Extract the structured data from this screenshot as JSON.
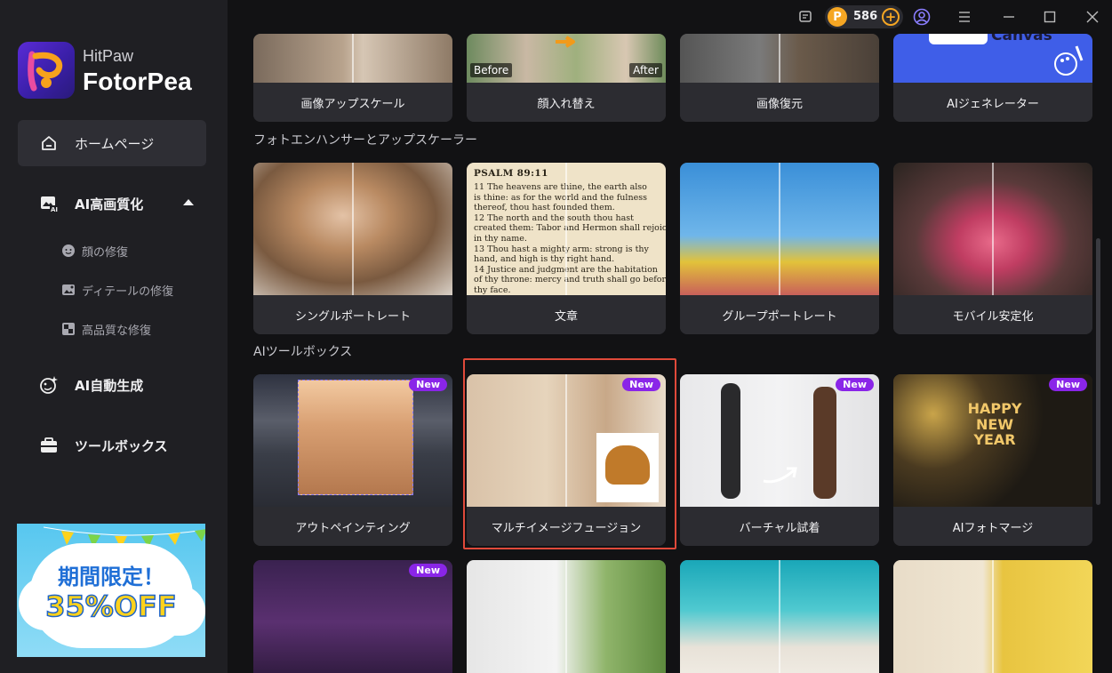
{
  "app": {
    "brand_top": "HitPaw",
    "brand_name": "FotorPea"
  },
  "topbar": {
    "coins": "586"
  },
  "sidebar": {
    "items": [
      {
        "label": "ホームページ",
        "icon": "home-icon"
      },
      {
        "label": "AI高画質化",
        "icon": "enhance-image-icon"
      },
      {
        "label": "AI自動生成",
        "icon": "ai-generate-icon"
      },
      {
        "label": "ツールボックス",
        "icon": "toolbox-icon"
      }
    ],
    "sub_items": [
      {
        "label": "顔の修復",
        "icon": "face-icon"
      },
      {
        "label": "ディテールの修復",
        "icon": "image-detail-icon"
      },
      {
        "label": "高品質な修復",
        "icon": "quality-icon"
      }
    ],
    "promo": {
      "line1": "期間限定！",
      "line2": "35%OFF"
    }
  },
  "row0": [
    {
      "label": "画像アップスケール"
    },
    {
      "label": "顔入れ替え",
      "before": "Before",
      "after": "After"
    },
    {
      "label": "画像復元"
    },
    {
      "label": "AIジェネレーター",
      "image_text": "Canvas"
    }
  ],
  "sections": {
    "enhancer": "フォトエンハンサーとアップスケーラー",
    "toolbox": "AIツールボックス"
  },
  "row1": [
    {
      "label": "シングルポートレート"
    },
    {
      "label": "文章",
      "heading": "PSALM 89:11",
      "lines": [
        "11  The heavens are thine, the earth also",
        "is thine: as for the world and the fulness",
        "thereof, thou hast founded them.",
        "12  The north and the south thou hast",
        "created them: Tabor and Hermon shall rejoice",
        "in thy name.",
        "13  Thou hast a mighty arm: strong is thy",
        "hand, and high is thy right hand.",
        "14  Justice and judgment are the habitation",
        "of thy throne: mercy and truth shall go before",
        "thy face."
      ]
    },
    {
      "label": "グループポートレート"
    },
    {
      "label": "モバイル安定化"
    }
  ],
  "row2": [
    {
      "label": "アウトペインティング",
      "badge": "New"
    },
    {
      "label": "マルチイメージフュージョン",
      "badge": "New"
    },
    {
      "label": "バーチャル試着",
      "badge": "New"
    },
    {
      "label": "AIフォトマージ",
      "badge": "New",
      "image_text": "HAPPY NEW YEAR"
    }
  ],
  "row3": [
    {
      "badge": "New"
    },
    {},
    {},
    {}
  ]
}
